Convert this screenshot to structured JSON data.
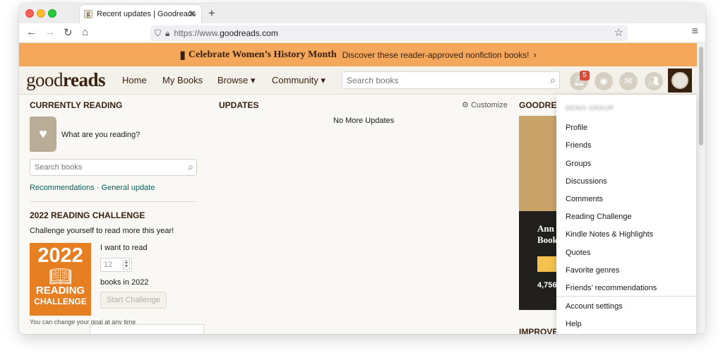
{
  "browser": {
    "tab_title": "Recent updates | Goodreads",
    "url_prefix": "https://www.",
    "url_domain": "goodreads.com"
  },
  "banner": {
    "title": "Celebrate Women’s History Month",
    "subtitle": "Discover these reader-approved nonfiction books!"
  },
  "header": {
    "logo_light": "good",
    "logo_bold": "reads",
    "nav": [
      "Home",
      "My Books",
      "Browse ▾",
      "Community ▾"
    ],
    "search_placeholder": "Search books",
    "notification_count": "5"
  },
  "left": {
    "currently_reading": "CURRENTLY READING",
    "what_reading": "What are you reading?",
    "search_placeholder": "Search books",
    "link_recommendations": "Recommendations",
    "link_separator": "·",
    "link_general": "General update",
    "challenge_heading": "2022 READING CHALLENGE",
    "challenge_text": "Challenge yourself to read more this year!",
    "badge_year": "2022",
    "badge_word1": "READING",
    "badge_word2": "CHALLENGE",
    "want_to_read": "I want to read",
    "goal_value": "12",
    "books_in": "books in 2022",
    "start_button": "Start Challenge",
    "change_goal": "You can change your goal at any time"
  },
  "middle": {
    "updates_heading": "UPDATES",
    "customize": "Customize",
    "no_more": "No More Updates"
  },
  "right": {
    "heading": "GOODREA",
    "ann_line1": "Ann",
    "ann_line2": "Book",
    "count": "4,756",
    "improve": "IMPROVE"
  },
  "dropdown": {
    "username": "DENIS GRAUR",
    "items": [
      "Profile",
      "Friends",
      "Groups",
      "Discussions",
      "Comments",
      "Reading Challenge",
      "Kindle Notes & Highlights",
      "Quotes",
      "Favorite genres",
      "Friends’ recommendations"
    ],
    "footer_items": [
      "Account settings",
      "Help"
    ]
  },
  "colors": {
    "banner": "#f5a85b",
    "header_bg": "#f4f1ea",
    "brand_brown": "#382110",
    "link_teal": "#00635d",
    "challenge_orange": "#e67e22",
    "badge_red": "#d84b3c"
  }
}
